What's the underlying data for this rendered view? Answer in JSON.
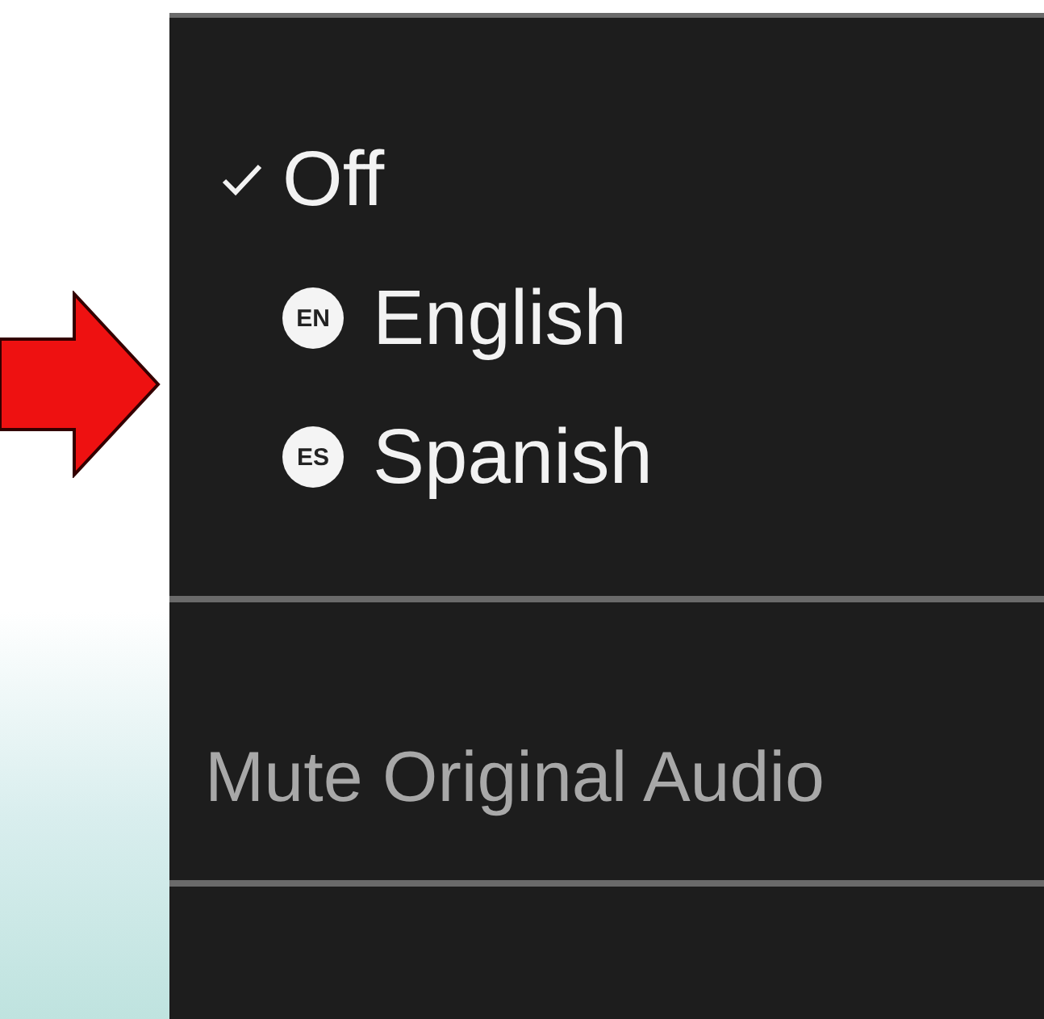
{
  "menu": {
    "items": [
      {
        "kind": "plain",
        "label": "Off",
        "checked": true
      },
      {
        "kind": "language",
        "badge": "EN",
        "label": "English",
        "checked": false
      },
      {
        "kind": "language",
        "badge": "ES",
        "label": "Spanish",
        "checked": false
      }
    ],
    "action": {
      "label": "Mute Original Audio",
      "disabled": true
    }
  }
}
